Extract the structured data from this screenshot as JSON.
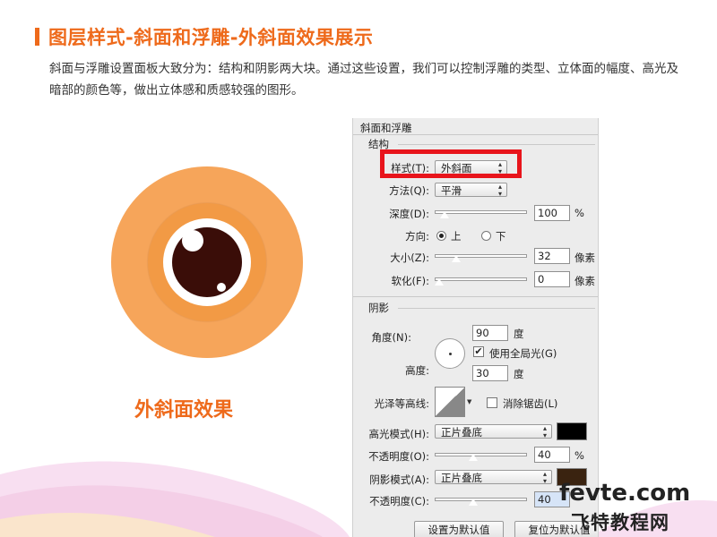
{
  "header": {
    "title": "图层样式-斜面和浮雕-外斜面效果展示",
    "intro": "斜面与浮雕设置面板大致分为：结构和阴影两大块。通过这些设置，我们可以控制浮雕的类型、立体面的幅度、高光及暗部的颜色等，做出立体感和质感较强的图形。"
  },
  "illustration": {
    "caption": "外斜面效果",
    "colors": {
      "outer": "#f6a55a",
      "ring": "#f29a45",
      "white": "#ffffff",
      "pupil": "#3a0d08"
    }
  },
  "panel": {
    "title": "斜面和浮雕",
    "structure": {
      "label": "结构",
      "style_label": "样式(T):",
      "style_value": "外斜面",
      "technique_label": "方法(Q):",
      "technique_value": "平滑",
      "depth_label": "深度(D):",
      "depth_value": "100",
      "depth_unit": "%",
      "direction_label": "方向:",
      "direction_up": "上",
      "direction_down": "下",
      "size_label": "大小(Z):",
      "size_value": "32",
      "size_unit": "像素",
      "soften_label": "软化(F):",
      "soften_value": "0",
      "soften_unit": "像素"
    },
    "shading": {
      "label": "阴影",
      "angle_label": "角度(N):",
      "angle_value": "90",
      "angle_unit": "度",
      "global_light_label": "使用全局光(G)",
      "altitude_label": "高度:",
      "altitude_value": "30",
      "altitude_unit": "度",
      "gloss_contour_label": "光泽等高线:",
      "antialias_label": "消除锯齿(L)",
      "highlight_mode_label": "高光模式(H):",
      "highlight_mode_value": "正片叠底",
      "highlight_color": "#000000",
      "highlight_opacity_label": "不透明度(O):",
      "highlight_opacity_value": "40",
      "highlight_opacity_unit": "%",
      "shadow_mode_label": "阴影模式(A):",
      "shadow_mode_value": "正片叠底",
      "shadow_color": "#3a2310",
      "shadow_opacity_label": "不透明度(C):",
      "shadow_opacity_value": "40"
    },
    "buttons": {
      "make_default": "设置为默认值",
      "reset_default": "复位为默认值"
    }
  },
  "watermark": {
    "line1": "fevte.com",
    "line2": "飞特教程网"
  }
}
